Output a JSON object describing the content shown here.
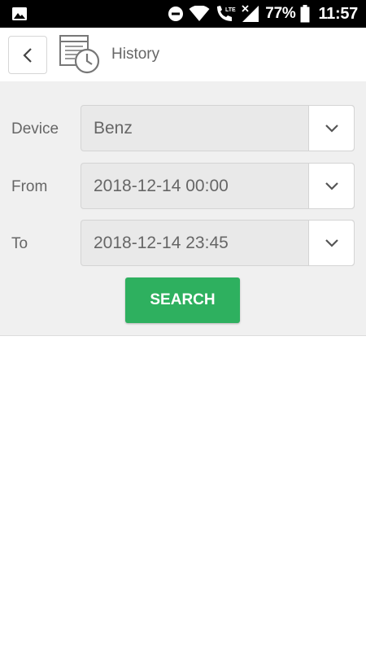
{
  "status_bar": {
    "battery_percent": "77%",
    "time": "11:57",
    "icons": [
      "gallery-icon",
      "dnd-icon",
      "wifi-icon",
      "lte-call-icon",
      "signal-icon",
      "battery-icon"
    ]
  },
  "header": {
    "title": "History",
    "back_icon": "chevron-left-icon",
    "app_icon": "history-report-icon"
  },
  "form": {
    "device_label": "Device",
    "device_value": "Benz",
    "from_label": "From",
    "from_value": "2018-12-14 00:00",
    "to_label": "To",
    "to_value": "2018-12-14 23:45",
    "search_label": "SEARCH"
  },
  "colors": {
    "status_bar": "#000000",
    "panel_bg": "#f0f0f0",
    "search_button": "#2eb05f"
  }
}
